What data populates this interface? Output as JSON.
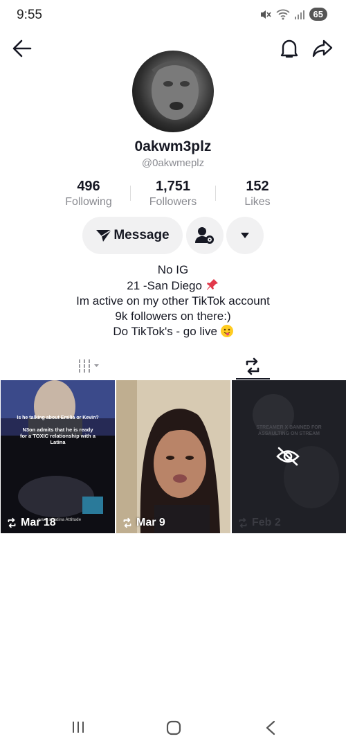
{
  "status_bar": {
    "time": "9:55",
    "battery": "65"
  },
  "profile": {
    "display_name": "0akwm3plz",
    "handle": "@0akwmeplz",
    "stats": [
      {
        "value": "496",
        "label": "Following"
      },
      {
        "value": "1,751",
        "label": "Followers"
      },
      {
        "value": "152",
        "label": "Likes"
      }
    ],
    "message_label": "Message",
    "bio": [
      "No IG",
      "21 -San Diego",
      "Im active on my other TikTok account",
      "9k followers on there:)",
      "Do TikTok's - go live"
    ]
  },
  "videos": [
    {
      "date": "Mar 18",
      "caption_top": "Is he talking about Emilia or Kevin?",
      "caption_main": "N3on admits that he is ready for a TOXIC relationship with a Latina",
      "caption_bottom": "want a Latina Attitude"
    },
    {
      "date": "Mar 9"
    },
    {
      "date": "Feb 2",
      "caption_main": "STREAMER X BANNED FOR ASSAULTING ON STREAM"
    }
  ],
  "colors": {
    "text": "#161823",
    "secondary": "#8a8b91",
    "button_bg": "#f1f1f2"
  }
}
